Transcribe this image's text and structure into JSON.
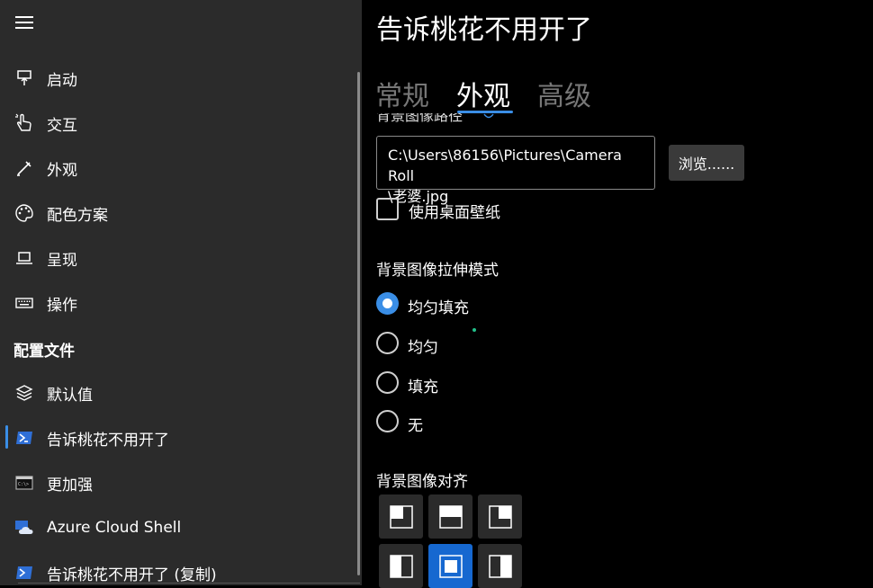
{
  "sidebar": {
    "items": [
      {
        "label": "启动",
        "icon": "startup-icon"
      },
      {
        "label": "交互",
        "icon": "interaction-icon"
      },
      {
        "label": "外观",
        "icon": "appearance-icon"
      },
      {
        "label": "配色方案",
        "icon": "color-palette-icon"
      },
      {
        "label": "呈现",
        "icon": "rendering-icon"
      },
      {
        "label": "操作",
        "icon": "keyboard-icon"
      }
    ],
    "profiles_header": "配置文件",
    "profiles": [
      {
        "label": "默认值",
        "icon": "layers-icon"
      },
      {
        "label": "告诉桃花不用开了",
        "icon": "powershell-icon",
        "selected": true
      },
      {
        "label": "更加强",
        "icon": "cmd-icon"
      },
      {
        "label": "Azure Cloud Shell",
        "icon": "azure-cloud-icon"
      },
      {
        "label": "告诉桃花不用开了 (复制)",
        "icon": "powershell-icon"
      }
    ]
  },
  "main": {
    "title": "告诉桃花不用开了",
    "tabs": [
      {
        "label": "常规",
        "active": false
      },
      {
        "label": "外观",
        "active": true
      },
      {
        "label": "高级",
        "active": false
      }
    ],
    "bg_path_label": "背景图像路径",
    "bg_path_value": "C:\\Users\\86156\\Pictures\\Camera Roll\\老婆.jpg",
    "bg_path_line1": "C:\\Users\\86156\\Pictures\\Camera Roll",
    "bg_path_line2": "\\老婆.jpg",
    "browse_label": "浏览......",
    "use_desktop_wallpaper": {
      "label": "使用桌面壁纸",
      "checked": false
    },
    "stretch_mode": {
      "label": "背景图像拉伸模式",
      "options": [
        "均匀填充",
        "均匀",
        "填充",
        "无"
      ],
      "selected": "均匀填充"
    },
    "alignment": {
      "label": "背景图像对齐",
      "options": [
        "top-left",
        "top",
        "top-right",
        "left",
        "center",
        "right"
      ],
      "selected": "center"
    }
  },
  "colors": {
    "accent": "#3a8ee6",
    "sidebar_bg": "#2b2b2b",
    "main_bg": "#000000",
    "inactive_tab": "#777777",
    "selected_align": "#1668d0"
  }
}
